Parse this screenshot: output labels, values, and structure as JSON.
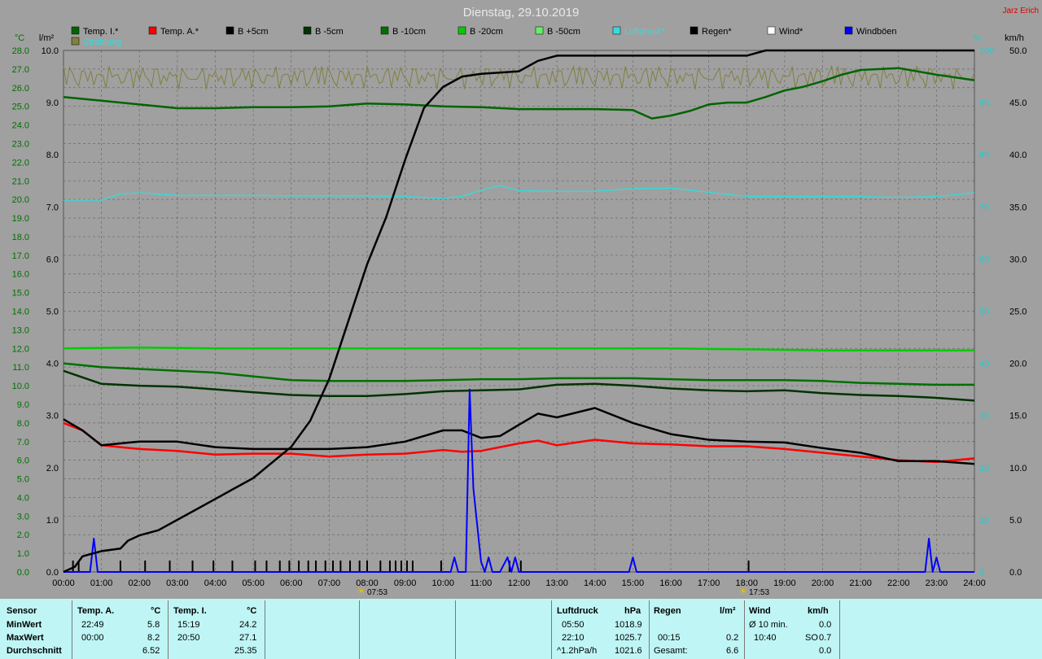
{
  "title": "Dienstag, 29.10.2019",
  "author": "Jarz Erich",
  "colors": {
    "temp_innen": "#006400",
    "temp_aussen": "#ff0000",
    "b5": "#000000",
    "b_5": "#003300",
    "b_10": "#007000",
    "b_20": "#00cc00",
    "b_50": "#66ee66",
    "luftdruck": "#33dddd",
    "regen": "#000000",
    "wind": "#ffffff",
    "windboeen": "#0000ff",
    "strahlung": "#808040"
  },
  "legend": [
    {
      "name": "Temp. I.*",
      "color": "#006400"
    },
    {
      "name": "Temp. A.*",
      "color": "#ff0000"
    },
    {
      "name": "B +5cm",
      "color": "#000000"
    },
    {
      "name": "B -5cm",
      "color": "#003300"
    },
    {
      "name": "B -10cm",
      "color": "#007000"
    },
    {
      "name": "B -20cm",
      "color": "#00cc00"
    },
    {
      "name": "B -50cm",
      "color": "#66ee66"
    },
    {
      "name": "Luftdruck*",
      "color": "#33dddd"
    },
    {
      "name": "Regen*",
      "color": "#000000"
    },
    {
      "name": "Wind*",
      "color": "#ffffff"
    },
    {
      "name": "Windböen",
      "color": "#0000ff"
    }
  ],
  "legend2": {
    "name": "Strahlung",
    "color": "#808040"
  },
  "axes": {
    "left1_unit": "°C",
    "left2_unit": "l/m²",
    "right1_unit": "%",
    "right2_unit": "km/h",
    "left1_ticks": [
      "28.0",
      "27.0",
      "26.0",
      "25.0",
      "24.0",
      "23.0",
      "22.0",
      "21.0",
      "20.0",
      "19.0",
      "18.0",
      "17.0",
      "16.0",
      "15.0",
      "14.0",
      "13.0",
      "12.0",
      "11.0",
      "10.0",
      "9.0",
      "8.0",
      "7.0",
      "6.0",
      "5.0",
      "4.0",
      "3.0",
      "2.0",
      "1.0",
      "0.0"
    ],
    "left2_ticks": [
      "10.0",
      "9.0",
      "8.0",
      "7.0",
      "6.0",
      "5.0",
      "4.0",
      "3.0",
      "2.0",
      "1.0",
      "0.0"
    ],
    "right1_ticks": [
      "100",
      "90",
      "80",
      "70",
      "60",
      "50",
      "40",
      "30",
      "20",
      "10",
      "0"
    ],
    "right2_ticks": [
      "50.0",
      "45.0",
      "40.0",
      "35.0",
      "30.0",
      "25.0",
      "20.0",
      "15.0",
      "10.0",
      "5.0",
      "0.0"
    ],
    "x_ticks": [
      "00:00",
      "01:00",
      "02:00",
      "03:00",
      "04:00",
      "05:00",
      "06:00",
      "07:00",
      "08:00",
      "09:00",
      "10:00",
      "11:00",
      "12:00",
      "13:00",
      "14:00",
      "15:00",
      "16:00",
      "17:00",
      "18:00",
      "19:00",
      "20:00",
      "21:00",
      "22:00",
      "23:00",
      "24:00"
    ],
    "sunrise": "07:53",
    "sunset": "17:53"
  },
  "chart_data": {
    "type": "line",
    "title": "Dienstag, 29.10.2019",
    "x_unit": "hours",
    "ylim_temp": [
      0,
      28
    ],
    "ylim_rain": [
      0,
      10
    ],
    "ylim_percent": [
      0,
      100
    ],
    "ylim_wind": [
      0,
      50
    ],
    "series": [
      {
        "name": "Temp. I.*",
        "axis": "temp",
        "color": "#006400",
        "x": [
          0,
          1,
          2,
          3,
          4,
          5,
          6,
          7,
          8,
          9,
          10,
          11,
          12,
          13,
          14,
          15,
          15.5,
          16,
          16.5,
          17,
          17.5,
          18,
          18.5,
          19,
          19.5,
          20,
          20.5,
          21,
          22,
          23,
          24
        ],
        "values": [
          25.5,
          25.3,
          25.1,
          24.9,
          24.9,
          24.95,
          24.95,
          25.0,
          25.15,
          25.1,
          25.0,
          24.95,
          24.85,
          24.85,
          24.85,
          24.8,
          24.35,
          24.5,
          24.75,
          25.1,
          25.2,
          25.2,
          25.5,
          25.85,
          26.05,
          26.35,
          26.7,
          26.95,
          27.05,
          26.7,
          26.4
        ]
      },
      {
        "name": "Temp. A.*",
        "axis": "temp",
        "color": "#ff0000",
        "x": [
          0,
          0.5,
          1,
          1.5,
          2,
          3,
          4,
          5,
          6,
          7,
          8,
          9,
          10,
          10.5,
          11,
          12,
          12.5,
          13,
          14,
          15,
          16,
          17,
          18,
          19,
          20,
          21,
          22,
          23,
          24
        ],
        "values": [
          8.0,
          7.6,
          6.8,
          6.7,
          6.6,
          6.5,
          6.3,
          6.35,
          6.35,
          6.2,
          6.3,
          6.35,
          6.55,
          6.45,
          6.5,
          6.9,
          7.05,
          6.8,
          7.1,
          6.9,
          6.85,
          6.75,
          6.75,
          6.6,
          6.4,
          6.2,
          6.0,
          5.9,
          6.1
        ]
      },
      {
        "name": "B +5cm",
        "axis": "temp",
        "color": "#000000",
        "x": [
          0,
          0.5,
          1,
          1.5,
          2,
          3,
          4,
          5,
          6,
          7,
          8,
          9,
          10,
          10.5,
          11,
          11.5,
          12,
          12.5,
          13,
          14,
          15,
          16,
          17,
          18,
          19,
          20,
          21,
          22,
          23,
          24
        ],
        "values": [
          8.2,
          7.6,
          6.8,
          6.9,
          7.0,
          7.0,
          6.7,
          6.6,
          6.6,
          6.6,
          6.7,
          7.0,
          7.6,
          7.6,
          7.2,
          7.3,
          7.9,
          8.5,
          8.3,
          8.8,
          8.0,
          7.4,
          7.1,
          7.0,
          6.95,
          6.65,
          6.4,
          5.95,
          5.95,
          5.8
        ]
      },
      {
        "name": "B -5cm",
        "axis": "temp",
        "color": "#003300",
        "x": [
          0,
          1,
          2,
          3,
          4,
          5,
          6,
          7,
          8,
          9,
          10,
          11,
          12,
          13,
          14,
          15,
          16,
          17,
          18,
          19,
          20,
          21,
          22,
          23,
          24
        ],
        "values": [
          10.8,
          10.1,
          10.0,
          9.95,
          9.8,
          9.65,
          9.5,
          9.45,
          9.45,
          9.55,
          9.7,
          9.75,
          9.8,
          10.05,
          10.1,
          10.0,
          9.85,
          9.75,
          9.7,
          9.75,
          9.6,
          9.5,
          9.45,
          9.35,
          9.2
        ]
      },
      {
        "name": "B -10cm",
        "axis": "temp",
        "color": "#007000",
        "x": [
          0,
          1,
          2,
          3,
          4,
          5,
          6,
          7,
          8,
          9,
          10,
          11,
          12,
          13,
          14,
          15,
          16,
          17,
          18,
          19,
          20,
          21,
          22,
          23,
          24
        ],
        "values": [
          11.2,
          11.0,
          10.9,
          10.8,
          10.7,
          10.5,
          10.3,
          10.25,
          10.25,
          10.25,
          10.3,
          10.35,
          10.35,
          10.4,
          10.4,
          10.4,
          10.35,
          10.3,
          10.3,
          10.3,
          10.25,
          10.15,
          10.1,
          10.05,
          10.05
        ]
      },
      {
        "name": "B -20cm",
        "axis": "temp",
        "color": "#00cc00",
        "x": [
          0,
          2,
          4,
          6,
          8,
          10,
          12,
          14,
          16,
          18,
          20,
          22,
          24
        ],
        "values": [
          12.0,
          12.05,
          12.0,
          12.0,
          12.0,
          12.0,
          12.0,
          12.0,
          12.0,
          11.95,
          11.9,
          11.9,
          11.9
        ]
      },
      {
        "name": "Luftdruck*",
        "axis": "percent",
        "color": "#33dddd",
        "x": [
          0,
          1,
          1.5,
          2,
          3,
          4,
          5,
          6,
          7,
          8,
          9,
          10,
          10.5,
          11,
          11.5,
          12,
          13,
          14,
          15,
          16,
          17,
          18,
          19,
          20,
          21,
          22,
          23,
          24
        ],
        "values": [
          71.3,
          71.3,
          72.5,
          72.7,
          72.2,
          72.2,
          72.2,
          72.1,
          72.1,
          72.1,
          72.0,
          71.6,
          72.0,
          73.2,
          74.1,
          73.1,
          73.0,
          73.0,
          73.5,
          73.6,
          72.8,
          72.0,
          72.0,
          72.0,
          72.0,
          71.8,
          72.0,
          72.7
        ]
      },
      {
        "name": "Windböen",
        "axis": "wind",
        "color": "#0000ff",
        "x": [
          0,
          0.7,
          0.8,
          0.9,
          10.2,
          10.3,
          10.4,
          10.6,
          10.7,
          10.8,
          11,
          11.1,
          11.2,
          11.3,
          11.5,
          11.7,
          11.8,
          11.9,
          12.0,
          12.1,
          14.9,
          15.0,
          15.1,
          22.7,
          22.8,
          22.9,
          23.0,
          23.1,
          24
        ],
        "values": [
          0,
          0,
          3.2,
          0,
          0,
          1.4,
          0,
          0,
          17.5,
          8,
          1,
          0,
          1.4,
          0,
          0,
          1.4,
          0,
          1.4,
          0,
          0,
          0,
          1.4,
          0,
          0,
          3.2,
          0,
          1.4,
          0,
          0
        ]
      },
      {
        "name": "Regen*",
        "axis": "rain",
        "type": "cumulative",
        "color": "#000000",
        "x": [
          0,
          0.3,
          0.5,
          1,
          1.5,
          1.7,
          2,
          2.5,
          3,
          3.5,
          4,
          4.5,
          5,
          5.5,
          6,
          6.5,
          7,
          7.5,
          8,
          8.5,
          9,
          9.5,
          10,
          10.5,
          11,
          12,
          12.5,
          13,
          14,
          15,
          16,
          17,
          18,
          18.5,
          19,
          20,
          21,
          22,
          23,
          24
        ],
        "values": [
          0,
          0.1,
          0.3,
          0.4,
          0.45,
          0.6,
          0.7,
          0.8,
          1.0,
          1.2,
          1.4,
          1.6,
          1.8,
          2.1,
          2.4,
          2.9,
          3.7,
          4.8,
          5.9,
          6.8,
          7.9,
          8.9,
          9.3,
          9.5,
          9.55,
          9.6,
          9.8,
          9.9,
          9.9,
          9.9,
          9.9,
          9.9,
          9.9,
          10.0,
          10.0,
          10.0,
          10.0,
          10.0,
          10.0,
          10.0
        ]
      }
    ],
    "regen_intervals": [
      0.25,
      0.4,
      1.5,
      2.15,
      2.8,
      3.4,
      3.95,
      4.45,
      5.05,
      5.35,
      5.7,
      5.95,
      6.2,
      6.45,
      6.65,
      6.9,
      7.1,
      7.3,
      7.55,
      7.8,
      8.0,
      8.35,
      8.6,
      8.75,
      8.9,
      9.05,
      9.2,
      9.95,
      11.75,
      12.05,
      18.05
    ]
  },
  "stats": {
    "sensor_label": "Sensor",
    "min_label": "MinWert",
    "max_label": "MaxWert",
    "avg_label": "Durchschnitt",
    "temp_a": {
      "title": "Temp. A.",
      "unit": "°C",
      "min_time": "22:49",
      "min": "5.8",
      "max_time": "00:00",
      "max": "8.2",
      "avg": "6.52"
    },
    "temp_i": {
      "title": "Temp. I.",
      "unit": "°C",
      "min_time": "15:19",
      "min": "24.2",
      "max_time": "20:50",
      "max": "27.1",
      "avg": "25.35"
    },
    "luftdruck": {
      "title": "Luftdruck",
      "unit": "hPa",
      "min_time": "05:50",
      "min": "1018.9",
      "max_time": "22:10",
      "max": "1025.7",
      "avg_label": "^1.2hPa/h",
      "avg": "1021.6"
    },
    "regen": {
      "title": "Regen",
      "unit": "l/m²",
      "max_time": "00:15",
      "max": "0.2",
      "total_label": "Gesamt:",
      "total": "6.6"
    },
    "wind": {
      "title": "Wind",
      "unit": "km/h",
      "min_label": "Ø 10 min.",
      "min": "0.0",
      "max_time": "10:40",
      "max_dir": "SO",
      "max": "0.7",
      "avg": "0.0"
    }
  }
}
